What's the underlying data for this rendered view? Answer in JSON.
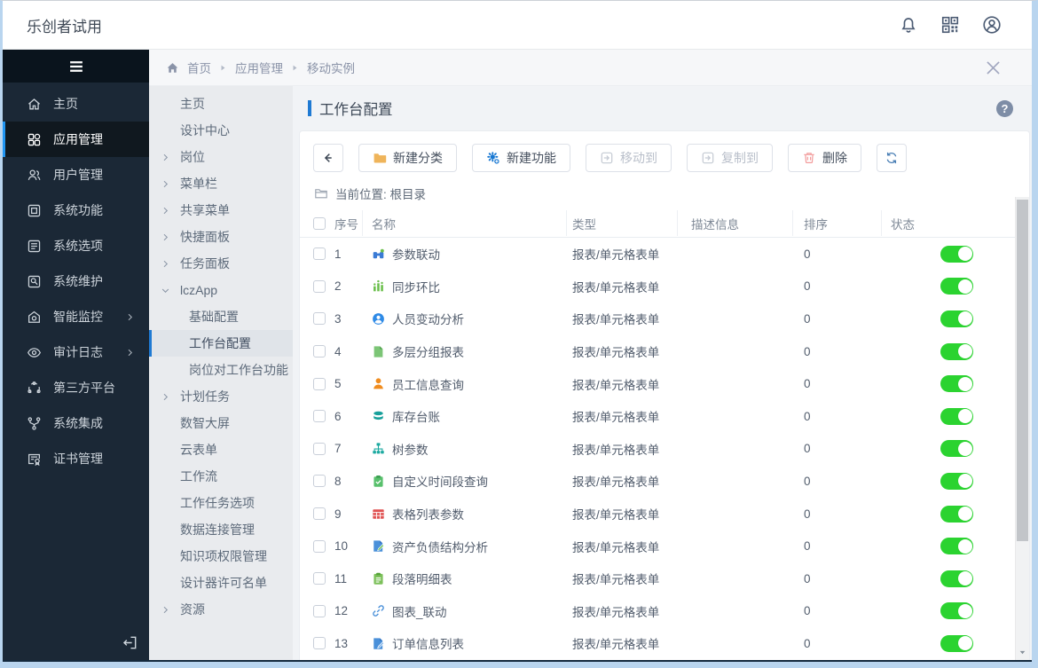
{
  "colors": {
    "accent_blue": "#1f7ad3",
    "sidebar_dark": "#1b2836",
    "selected_blue": "#2196f3",
    "toggle_on_green": "#2bd330",
    "folder_orange": "#efb45a",
    "gear_blue": "#1677d2",
    "danger_pink": "#f29b9b"
  },
  "topbar": {
    "title": "乐创者试用",
    "icons": [
      {
        "name": "bell"
      },
      {
        "name": "qr-code"
      },
      {
        "name": "avatar"
      }
    ]
  },
  "sidebar": {
    "items": [
      {
        "label": "主页",
        "icon": "home"
      },
      {
        "label": "应用管理",
        "icon": "apps",
        "selected": true
      },
      {
        "label": "用户管理",
        "icon": "users"
      },
      {
        "label": "系统功能",
        "icon": "monitor"
      },
      {
        "label": "系统选项",
        "icon": "list"
      },
      {
        "label": "系统维护",
        "icon": "tool"
      },
      {
        "label": "智能监控",
        "icon": "monitor-eye",
        "chevron": true
      },
      {
        "label": "审计日志",
        "icon": "eye",
        "chevron": true
      },
      {
        "label": "第三方平台",
        "icon": "ring"
      },
      {
        "label": "系统集成",
        "icon": "branch"
      },
      {
        "label": "证书管理",
        "icon": "cert"
      }
    ]
  },
  "breadcrumb": {
    "items": [
      "首页",
      "应用管理",
      "移动实例"
    ]
  },
  "subnav": {
    "items": [
      {
        "label": "主页"
      },
      {
        "label": "设计中心"
      },
      {
        "label": "岗位",
        "expand": "right"
      },
      {
        "label": "菜单栏",
        "expand": "right"
      },
      {
        "label": "共享菜单",
        "expand": "right"
      },
      {
        "label": "快捷面板",
        "expand": "right"
      },
      {
        "label": "任务面板",
        "expand": "right"
      },
      {
        "label": "lczApp",
        "expand": "down"
      },
      {
        "label": "基础配置",
        "sub": true
      },
      {
        "label": "工作台配置",
        "sub": true,
        "selected": true
      },
      {
        "label": "岗位对工作台功能",
        "sub": true
      },
      {
        "label": "计划任务",
        "expand": "right"
      },
      {
        "label": "数智大屏"
      },
      {
        "label": "云表单"
      },
      {
        "label": "工作流"
      },
      {
        "label": "工作任务选项"
      },
      {
        "label": "数据连接管理"
      },
      {
        "label": "知识项权限管理"
      },
      {
        "label": "设计器许可名单"
      },
      {
        "label": "资源",
        "expand": "right"
      }
    ]
  },
  "page": {
    "title": "工作台配置",
    "help": "?"
  },
  "toolbar": {
    "buttons": [
      {
        "label": "新建分类",
        "icon": "folder"
      },
      {
        "label": "新建功能",
        "icon": "gear-plus"
      },
      {
        "label": "移动到",
        "icon": "move",
        "disabled": true
      },
      {
        "label": "复制到",
        "icon": "copy",
        "disabled": true
      },
      {
        "label": "删除",
        "icon": "trash",
        "danger": true
      }
    ]
  },
  "location": {
    "label": "当前位置: 根目录"
  },
  "table": {
    "headers": [
      "序号",
      "名称",
      "类型",
      "描述信息",
      "排序",
      "状态"
    ],
    "rows": [
      {
        "num": "1",
        "name": "参数联动",
        "icon": "binoculars",
        "type": "报表/单元格表单",
        "desc": "",
        "sort": "0",
        "status": true
      },
      {
        "num": "2",
        "name": "同步环比",
        "icon": "bar-chart",
        "type": "报表/单元格表单",
        "desc": "",
        "sort": "0",
        "status": true
      },
      {
        "num": "3",
        "name": "人员变动分析",
        "icon": "person-circle",
        "type": "报表/单元格表单",
        "desc": "",
        "sort": "0",
        "status": true
      },
      {
        "num": "4",
        "name": "多层分组报表",
        "icon": "doc-green",
        "type": "报表/单元格表单",
        "desc": "",
        "sort": "0",
        "status": true
      },
      {
        "num": "5",
        "name": "员工信息查询",
        "icon": "person-orange",
        "type": "报表/单元格表单",
        "desc": "",
        "sort": "0",
        "status": true
      },
      {
        "num": "6",
        "name": "库存台账",
        "icon": "coins",
        "type": "报表/单元格表单",
        "desc": "",
        "sort": "0",
        "status": true
      },
      {
        "num": "7",
        "name": "树参数",
        "icon": "tree",
        "type": "报表/单元格表单",
        "desc": "",
        "sort": "0",
        "status": true
      },
      {
        "num": "8",
        "name": "自定义时间段查询",
        "icon": "clipboard-check",
        "type": "报表/单元格表单",
        "desc": "",
        "sort": "0",
        "status": true
      },
      {
        "num": "9",
        "name": "表格列表参数",
        "icon": "table-grid",
        "type": "报表/单元格表单",
        "desc": "",
        "sort": "0",
        "status": true
      },
      {
        "num": "10",
        "name": "资产负债结构分析",
        "icon": "doc-pencil-green",
        "type": "报表/单元格表单",
        "desc": "",
        "sort": "0",
        "status": true
      },
      {
        "num": "11",
        "name": "段落明细表",
        "icon": "clipboard-lines",
        "type": "报表/单元格表单",
        "desc": "",
        "sort": "0",
        "status": true
      },
      {
        "num": "12",
        "name": "图表_联动",
        "icon": "link",
        "type": "报表/单元格表单",
        "desc": "",
        "sort": "0",
        "status": true
      },
      {
        "num": "13",
        "name": "订单信息列表",
        "icon": "doc-pencil-blue",
        "type": "报表/单元格表单",
        "desc": "",
        "sort": "0",
        "status": true
      }
    ]
  }
}
